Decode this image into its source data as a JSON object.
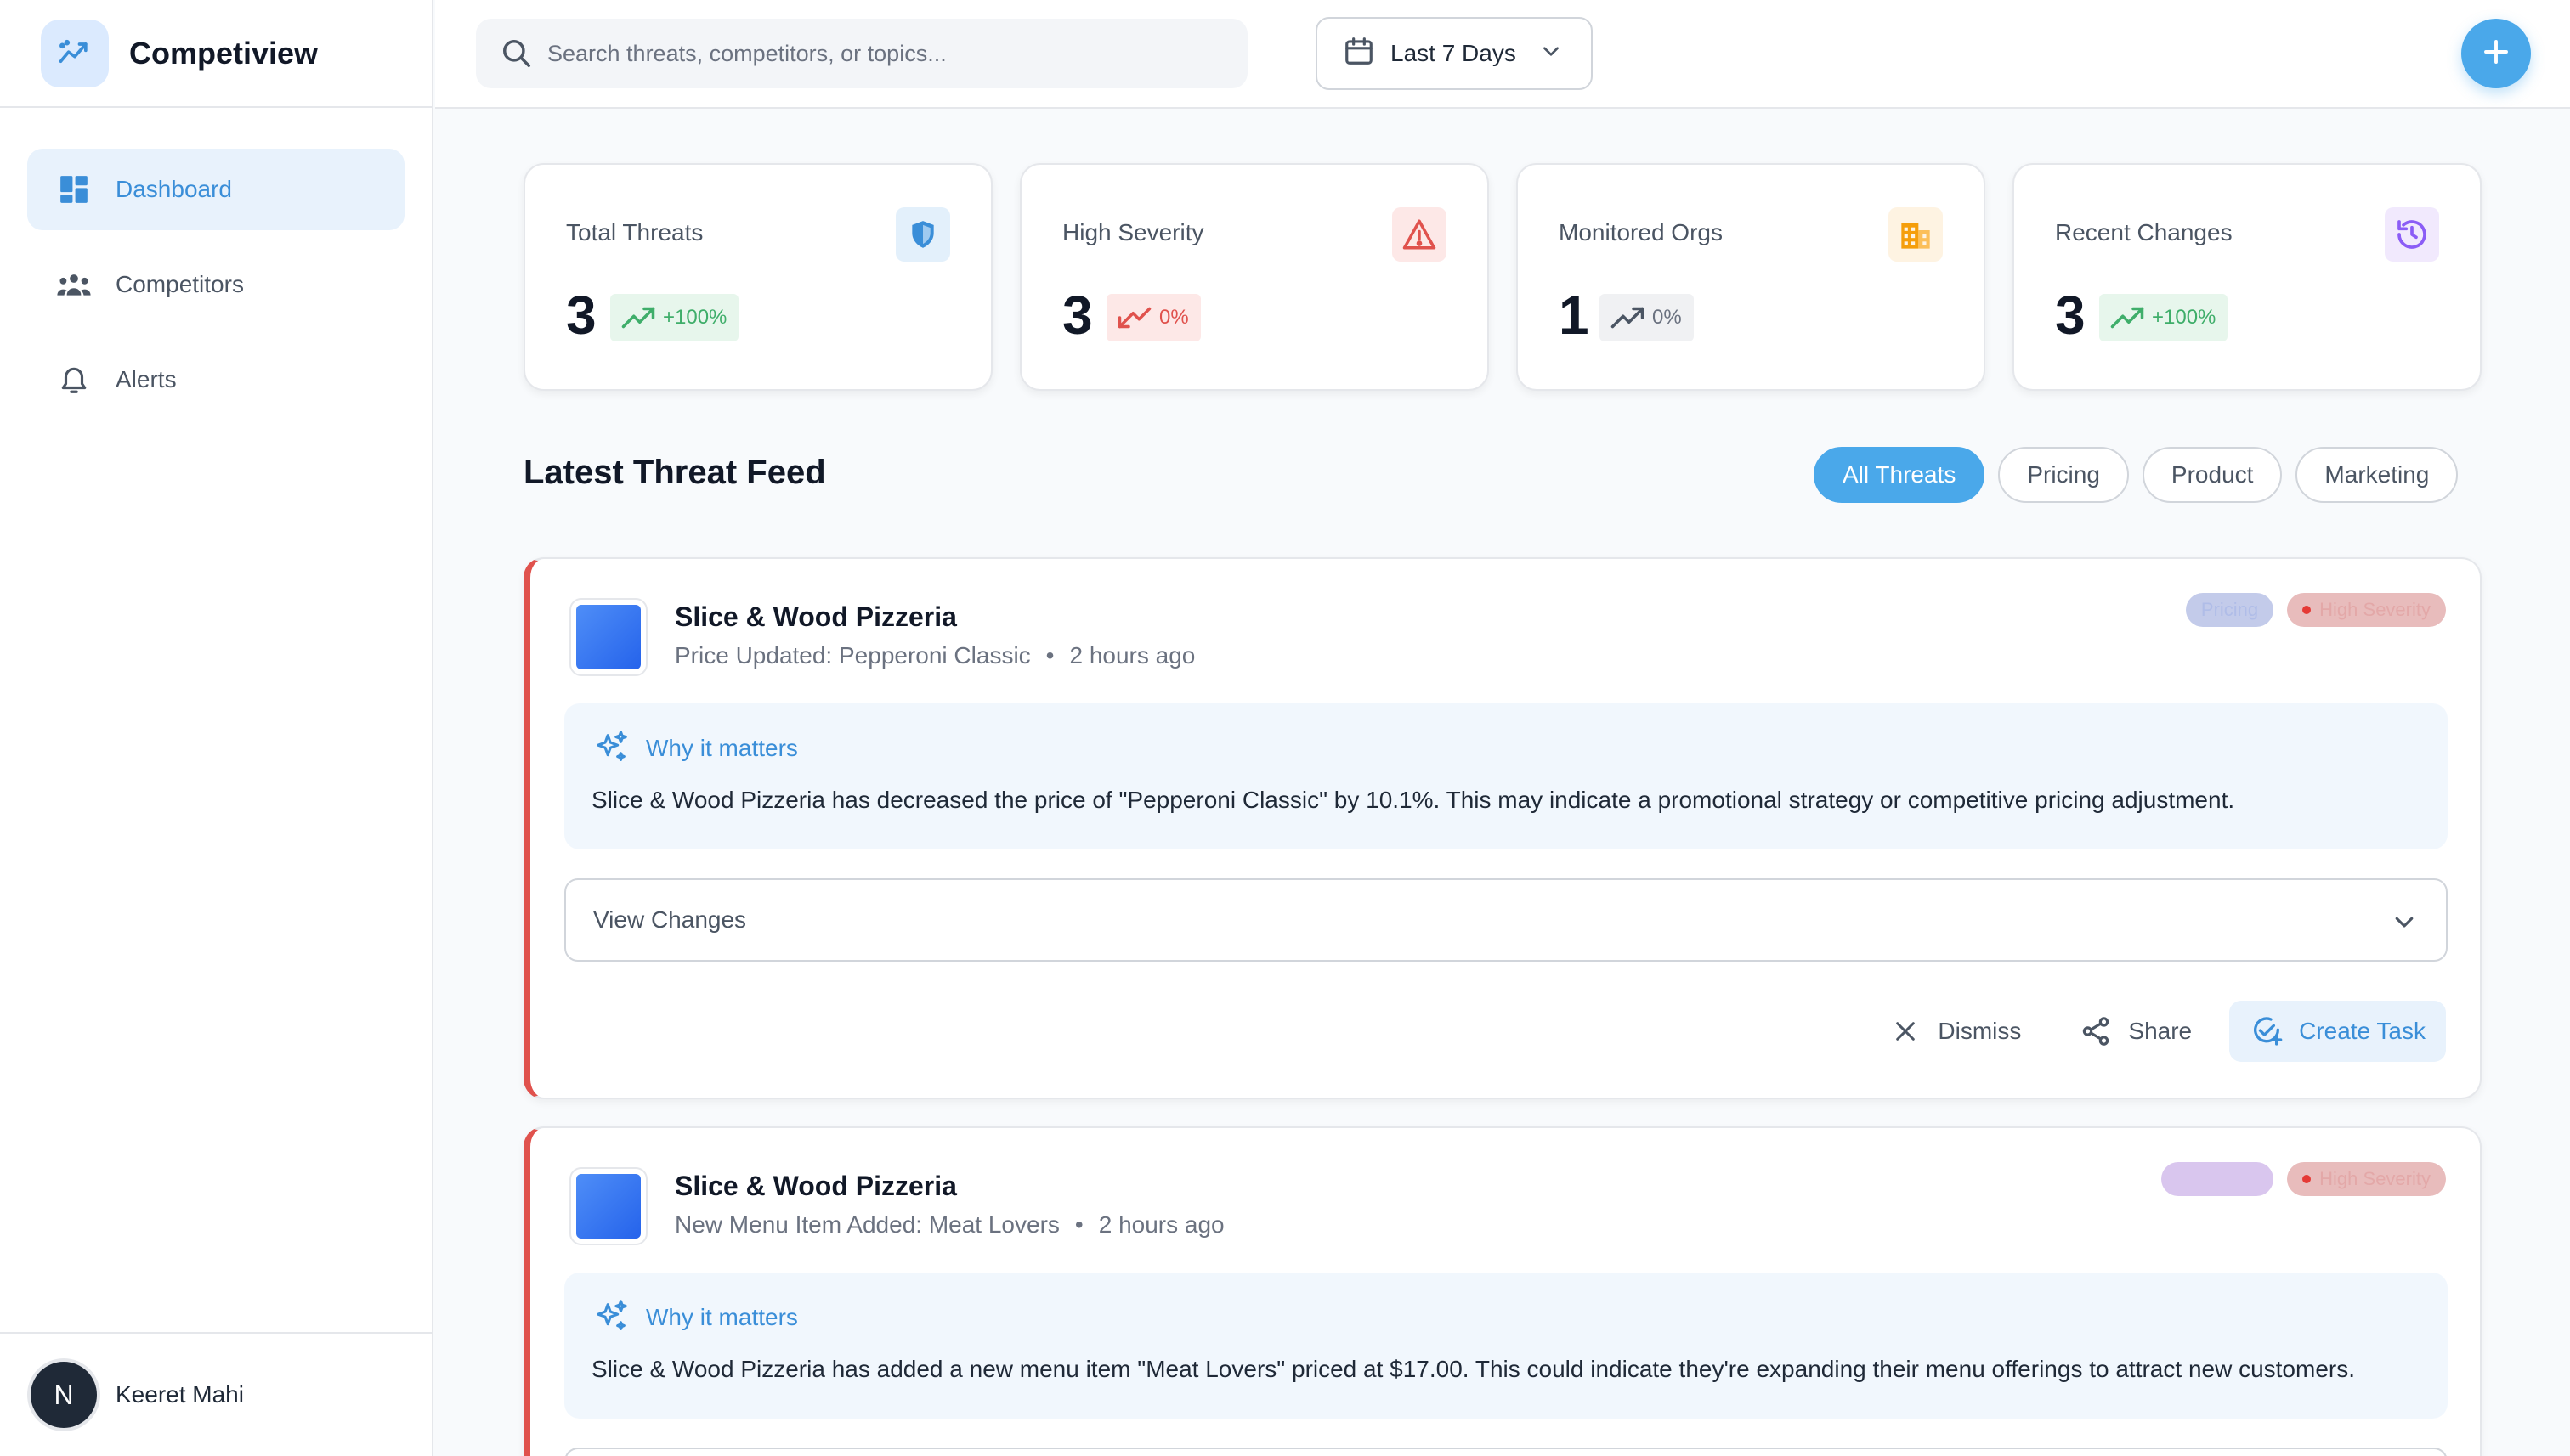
{
  "app": {
    "name": "Competiview",
    "brand_icon": "trend-line-icon"
  },
  "sidebar": {
    "items": [
      {
        "label": "Dashboard",
        "icon": "dashboard-grid-icon",
        "active": true
      },
      {
        "label": "Competitors",
        "icon": "users-group-icon",
        "active": false
      },
      {
        "label": "Alerts",
        "icon": "bell-icon",
        "active": false
      }
    ],
    "user": {
      "name": "Keeret Mahi",
      "initial": "N"
    }
  },
  "topbar": {
    "search_placeholder": "Search threats, competitors, or topics...",
    "date_range": "Last 7 Days",
    "add_icon": "plus-icon",
    "accent": "#4aa8ea"
  },
  "stats": [
    {
      "label": "Total Threats",
      "value": "3",
      "change": "+100%",
      "trend": "up",
      "icon": "shield-icon",
      "color": "#3a8ed8"
    },
    {
      "label": "High Severity",
      "value": "3",
      "change": "0%",
      "trend": "down",
      "icon": "warning-triangle-icon",
      "color": "#e0524d"
    },
    {
      "label": "Monitored Orgs",
      "value": "1",
      "change": "0%",
      "trend": "up",
      "icon": "building-icon",
      "color": "#f59e0b"
    },
    {
      "label": "Recent Changes",
      "value": "3",
      "change": "+100%",
      "trend": "up",
      "icon": "history-icon",
      "color": "#8b5cf6"
    }
  ],
  "feed": {
    "title": "Latest Threat Feed",
    "filters": [
      {
        "label": "All Threats",
        "active": true
      },
      {
        "label": "Pricing",
        "active": false
      },
      {
        "label": "Product",
        "active": false
      },
      {
        "label": "Marketing",
        "active": false
      }
    ],
    "items": [
      {
        "competitor": "Slice & Wood Pizzeria",
        "event": "Price Updated: Pepperoni Classic",
        "time": "2 hours ago",
        "category": "Pricing",
        "severity": "High Severity",
        "why_label": "Why it matters",
        "why_text": "Slice & Wood Pizzeria has decreased the price of \"Pepperoni Classic\" by 10.1%. This may indicate a promotional strategy or competitive pricing adjustment.",
        "view_changes": "View Changes",
        "actions": {
          "dismiss": "Dismiss",
          "share": "Share",
          "create_task": "Create Task"
        }
      },
      {
        "competitor": "Slice & Wood Pizzeria",
        "event": "New Menu Item Added: Meat Lovers",
        "time": "2 hours ago",
        "category": "",
        "severity": "High Severity",
        "why_label": "Why it matters",
        "why_text": "Slice & Wood Pizzeria has added a new menu item \"Meat Lovers\" priced at $17.00. This could indicate they're expanding their menu offerings to attract new customers."
      }
    ]
  }
}
